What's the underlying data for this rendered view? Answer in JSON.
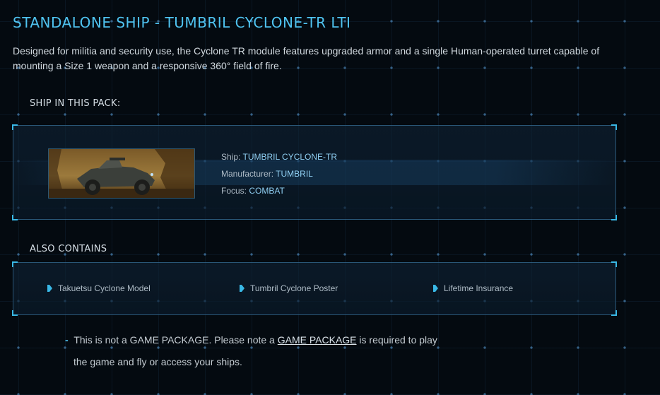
{
  "title": "STANDALONE SHIP - TUMBRIL CYCLONE-TR LTI",
  "description": "Designed for militia and security use, the Cyclone TR module features upgraded armor and a single Human-operated turret capable of mounting a Size 1 weapon and a responsive 360° field of fire.",
  "ship_section": {
    "heading": "SHIP IN THIS PACK:",
    "image_alt": "Tumbril Cyclone-TR vehicle",
    "details": {
      "ship_label": "Ship:",
      "ship_value": "TUMBRIL CYCLONE-TR",
      "manufacturer_label": "Manufacturer:",
      "manufacturer_value": "TUMBRIL",
      "focus_label": "Focus:",
      "focus_value": "COMBAT"
    }
  },
  "contains_section": {
    "heading": "ALSO CONTAINS",
    "items": [
      {
        "label": "Takuetsu Cyclone Model",
        "icon": "bullet-icon"
      },
      {
        "label": "Tumbril Cyclone Poster",
        "icon": "bullet-icon"
      },
      {
        "label": "Lifetime Insurance",
        "icon": "bullet-icon"
      }
    ]
  },
  "notice": {
    "prefix": "This is not a GAME PACKAGE. Please note a",
    "link": "GAME PACKAGE",
    "suffix": "is required to play",
    "line2": "the game and fly or access your ships."
  },
  "colors": {
    "accent": "#4fc3f0",
    "background": "#040a10",
    "panel_border": "#3a88b8"
  }
}
